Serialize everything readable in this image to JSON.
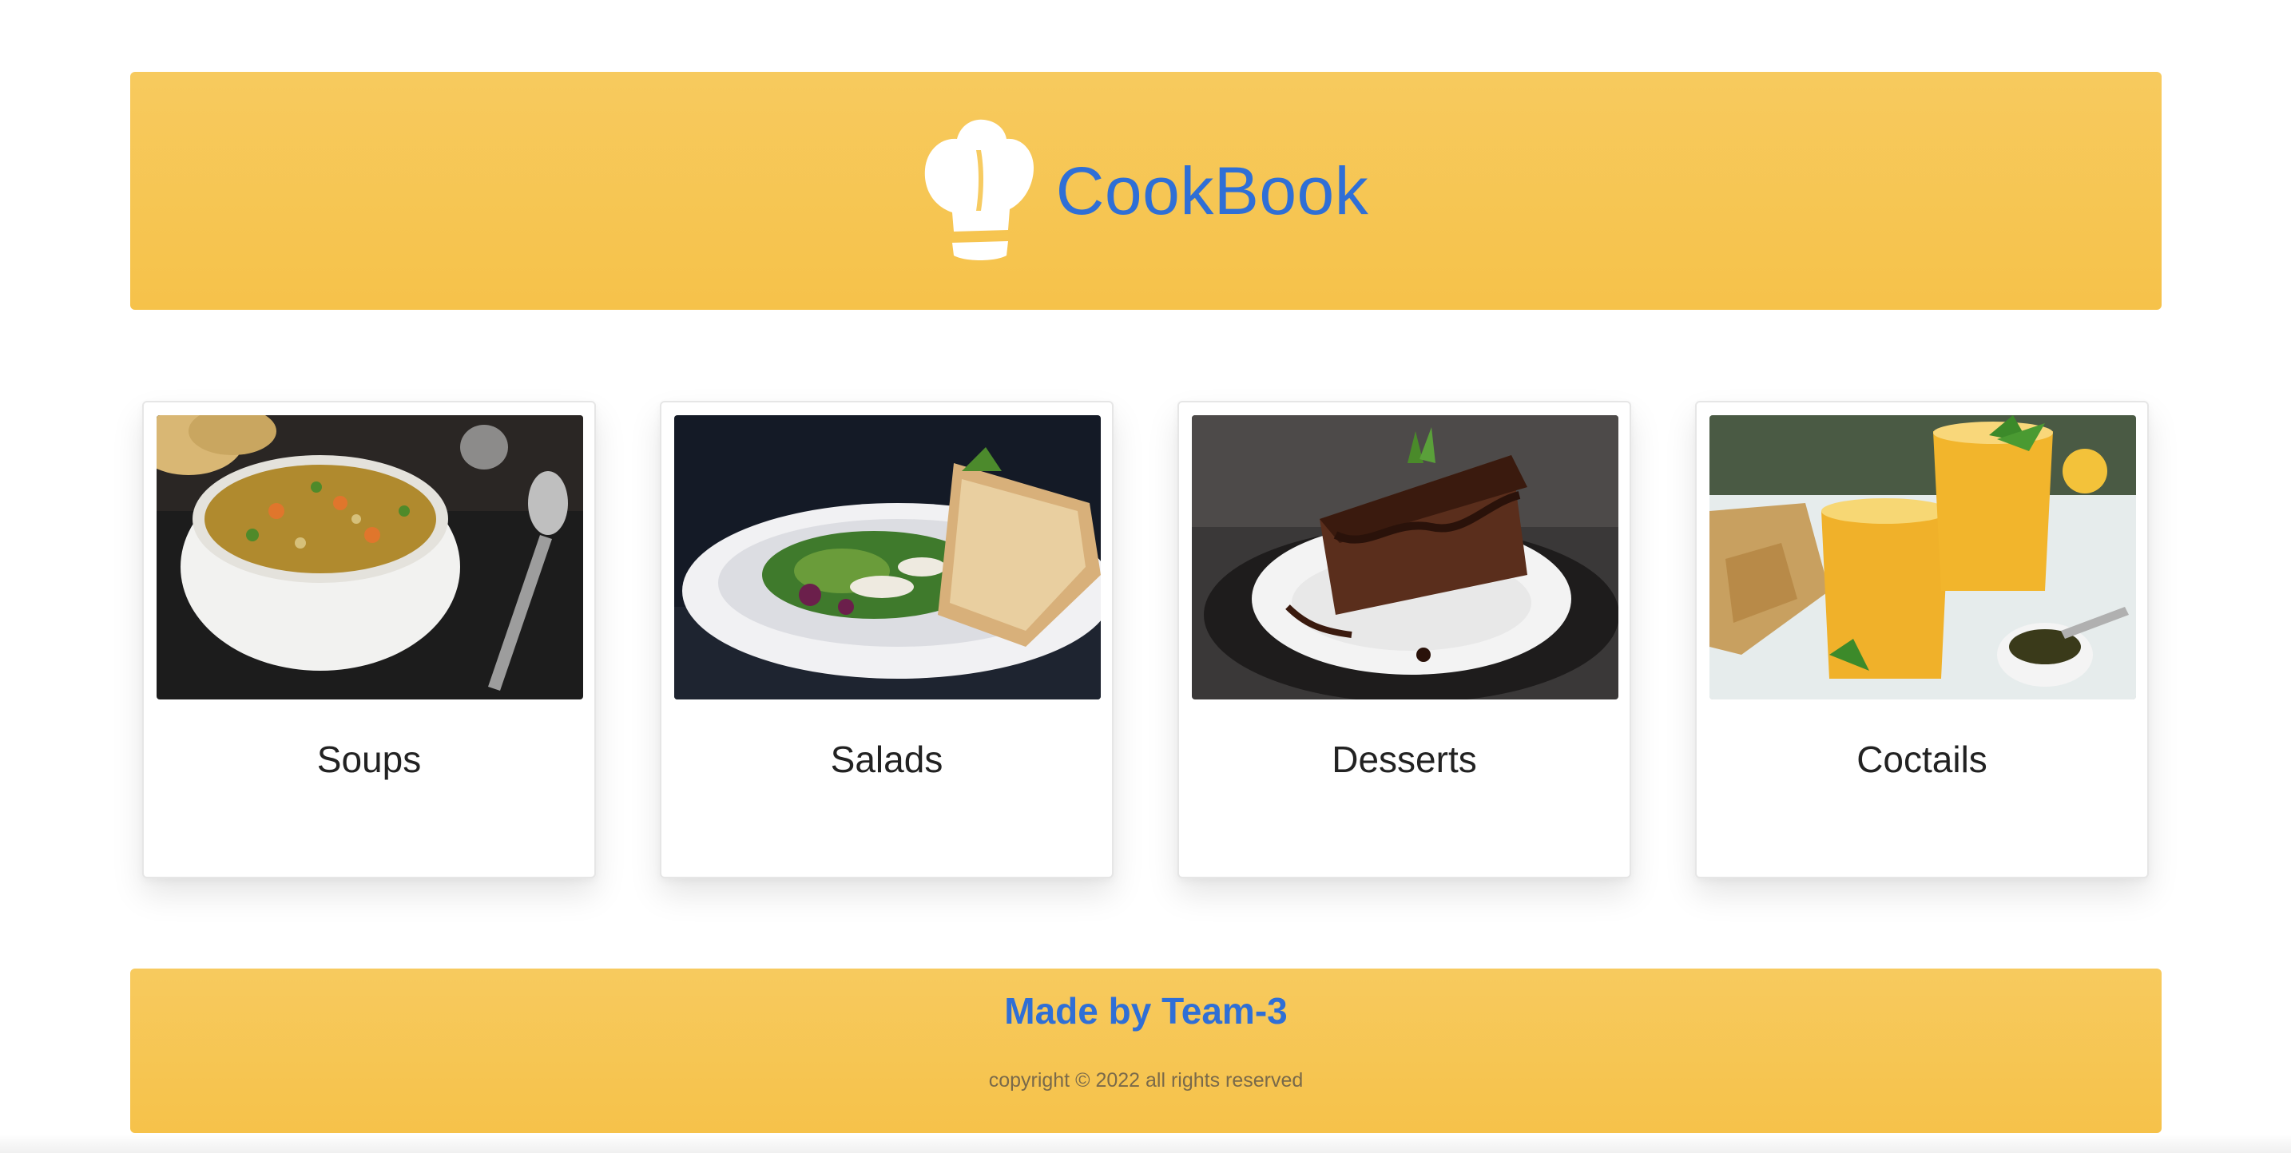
{
  "header": {
    "logo_icon": "chef-hat-icon",
    "title": "CookBook",
    "background_color": "#f6c550",
    "title_color": "#2f6fd6"
  },
  "categories": [
    {
      "label": "Soups",
      "image": "soup-bowl-photo"
    },
    {
      "label": "Salads",
      "image": "salad-plate-photo"
    },
    {
      "label": "Desserts",
      "image": "chocolate-cake-photo"
    },
    {
      "label": "Coctails",
      "image": "lemonade-glasses-photo"
    }
  ],
  "footer": {
    "made_by": "Made by Team-3",
    "copyright": "copyright © 2022 all rights reserved"
  }
}
